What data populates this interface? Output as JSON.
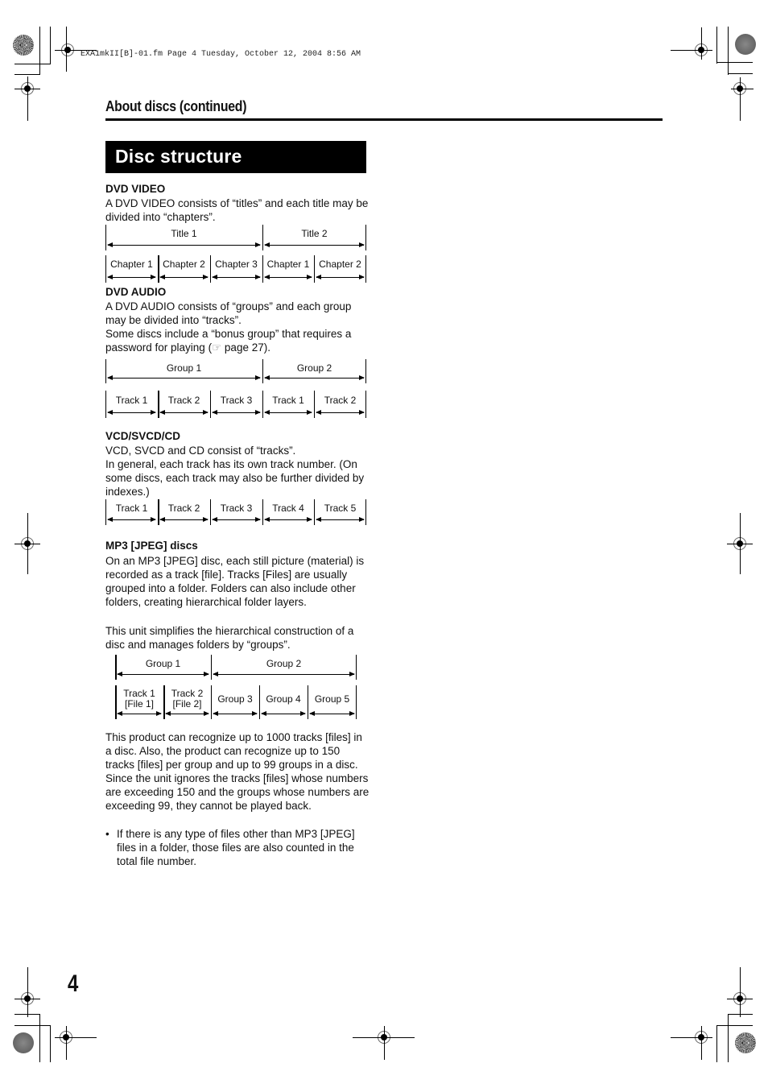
{
  "print_header": "EXA1mkII[B]-01.fm  Page 4  Tuesday, October 12, 2004  8:56 AM",
  "running_head": "About discs (continued)",
  "section_title": "Disc structure",
  "dvd_video": {
    "heading": "DVD VIDEO",
    "text": "A DVD VIDEO consists of “titles” and each title may be divided into “chapters”.",
    "top_row": [
      "Title 1",
      "Title 2"
    ],
    "bottom_row": [
      "Chapter 1",
      "Chapter 2",
      "Chapter 3",
      "Chapter 1",
      "Chapter 2"
    ]
  },
  "dvd_audio": {
    "heading": "DVD AUDIO",
    "text1": "A DVD AUDIO consists of “groups” and each group may be divided into “tracks”.",
    "text2_before": "Some discs include a “bonus group” that requires a password for playing (",
    "ref_icon": "☞",
    "text2_after": " page 27).",
    "top_row": [
      "Group 1",
      "Group 2"
    ],
    "bottom_row": [
      "Track 1",
      "Track 2",
      "Track 3",
      "Track 1",
      "Track 2"
    ]
  },
  "vcd": {
    "heading": "VCD/SVCD/CD",
    "text1": "VCD, SVCD and CD consist of “tracks”.",
    "text2": "In general, each track has its own track number. (On some discs, each track may also be further divided by indexes.)",
    "row": [
      "Track 1",
      "Track 2",
      "Track 3",
      "Track 4",
      "Track 5"
    ]
  },
  "mp3": {
    "heading": "MP3 [JPEG] discs",
    "text1": "On an MP3 [JPEG] disc, each still picture (material) is recorded as a track [file]. Tracks [Files] are usually grouped into a folder. Folders can also include other folders, creating hierarchical folder layers.",
    "text2": "This unit simplifies the hierarchical construction of a disc and manages folders by “groups”.",
    "top_row": [
      "Group 1",
      "Group 2"
    ],
    "bottom_row": [
      {
        "line1": "Track 1",
        "line2": "[File 1]"
      },
      {
        "line1": "Track 2",
        "line2": "[File 2]"
      },
      {
        "line1": "Group 3",
        "line2": ""
      },
      {
        "line1": "Group 4",
        "line2": ""
      },
      {
        "line1": "Group 5",
        "line2": ""
      }
    ],
    "text3": "This product can recognize up to 1000 tracks [files] in a disc. Also, the product can recognize up to 150 tracks [files] per group and up to 99 groups in a disc. Since the unit ignores the tracks [files] whose numbers are exceeding 150 and the groups whose numbers are exceeding 99, they cannot be played back.",
    "bullet": "If there is any type of files other than MP3 [JPEG] files in a folder, those files are also counted in the total file number.",
    "bullet_mark": "•"
  },
  "page_number": "4"
}
